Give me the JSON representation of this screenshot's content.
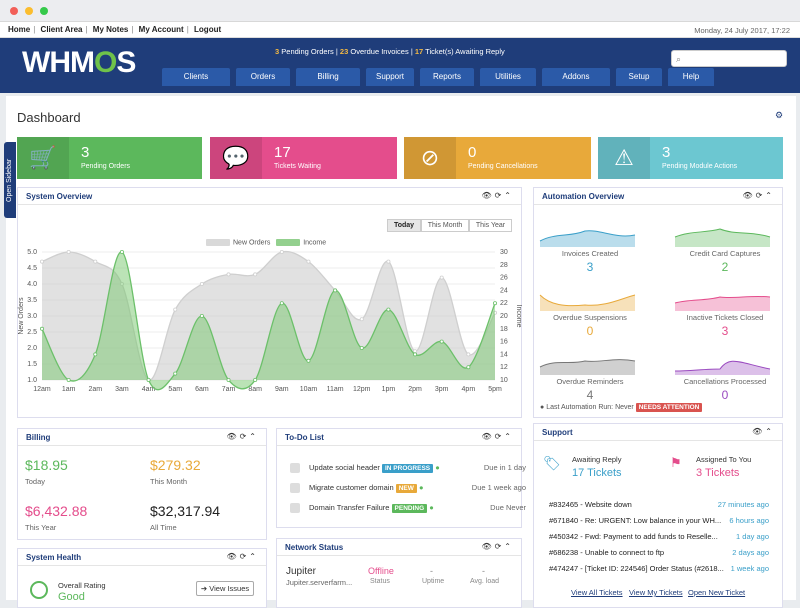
{
  "topbar": {
    "links": [
      "Home",
      "Client Area",
      "My Notes",
      "My Account",
      "Logout"
    ],
    "date": "Monday, 24 July 2017, 17:22"
  },
  "header": {
    "logo_prefix": "WHM",
    "logo_o": "O",
    "logo_suffix": "S",
    "alerts": {
      "pending_orders_n": "3",
      "pending_orders_l": "Pending Orders",
      "overdue_n": "23",
      "overdue_l": "Overdue Invoices",
      "tickets_n": "17",
      "tickets_l": "Ticket(s) Awaiting Reply"
    },
    "search_placeholder": ""
  },
  "nav": [
    "Clients",
    "Orders",
    "Billing",
    "Support",
    "Reports",
    "Utilities",
    "Addons",
    "Setup",
    "Help"
  ],
  "sidebar_tab": "Open Sidebar",
  "page_title": "Dashboard",
  "tiles": [
    {
      "num": "3",
      "label": "Pending Orders",
      "color": "#5cb85c",
      "icon": "cart-icon"
    },
    {
      "num": "17",
      "label": "Tickets Waiting",
      "color": "#e44d8c",
      "icon": "chat-icon"
    },
    {
      "num": "0",
      "label": "Pending Cancellations",
      "color": "#e8a93a",
      "icon": "ban-icon"
    },
    {
      "num": "3",
      "label": "Pending Module Actions",
      "color": "#6cc7d1",
      "icon": "warning-icon"
    }
  ],
  "system_overview": {
    "title": "System Overview",
    "tabs": [
      "Today",
      "This Month",
      "This Year"
    ],
    "legend": [
      "New Orders",
      "Income"
    ]
  },
  "chart_data": {
    "type": "area",
    "x": [
      "12am",
      "1am",
      "2am",
      "3am",
      "4am",
      "5am",
      "6am",
      "7am",
      "8am",
      "9am",
      "10am",
      "11am",
      "12pm",
      "1pm",
      "2pm",
      "3pm",
      "4pm",
      "5pm"
    ],
    "ylabel": "New Orders",
    "y2label": "Income",
    "ylim": [
      1.0,
      5.0
    ],
    "y2lim": [
      10,
      30
    ],
    "yticks": [
      "1.0",
      "1.5",
      "2.0",
      "2.5",
      "3.0",
      "3.5",
      "4.0",
      "4.5",
      "5.0"
    ],
    "y2ticks": [
      "10",
      "12",
      "14",
      "16",
      "18",
      "20",
      "22",
      "24",
      "26",
      "28",
      "30"
    ],
    "series": [
      {
        "name": "New Orders",
        "axis": "left",
        "color": "#cfcfcf",
        "values": [
          4.7,
          5.0,
          4.7,
          4.0,
          1.0,
          3.2,
          4.0,
          4.3,
          4.3,
          5.0,
          4.7,
          3.8,
          2.9,
          4.7,
          1.9,
          4.2,
          1.8,
          3.1
        ]
      },
      {
        "name": "Income",
        "axis": "right",
        "color": "#6cc06a",
        "values": [
          18,
          10,
          14,
          30,
          10,
          11,
          20,
          10,
          10,
          22,
          13,
          24,
          15,
          21,
          14,
          16,
          12,
          22
        ]
      }
    ]
  },
  "automation": {
    "title": "Automation Overview",
    "cells": [
      {
        "label": "Invoices Created",
        "value": "3",
        "color": "#3a9fc9"
      },
      {
        "label": "Credit Card Captures",
        "value": "2",
        "color": "#5cb85c"
      },
      {
        "label": "Overdue Suspensions",
        "value": "0",
        "color": "#e8a93a"
      },
      {
        "label": "Inactive Tickets Closed",
        "value": "3",
        "color": "#e44d8c"
      },
      {
        "label": "Overdue Reminders",
        "value": "4",
        "color": "#777777"
      },
      {
        "label": "Cancellations Processed",
        "value": "0",
        "color": "#9a4ac0"
      }
    ],
    "last_run": "Last Automation Run: Never",
    "needs_attention": "NEEDS ATTENTION"
  },
  "billing": {
    "title": "Billing",
    "today": "$18.95",
    "today_l": "Today",
    "month": "$279.32",
    "month_l": "This Month",
    "year": "$6,432.88",
    "year_l": "This Year",
    "all": "$32,317.94",
    "all_l": "All Time"
  },
  "todo": {
    "title": "To-Do List",
    "items": [
      {
        "text": "Update social header",
        "badge": "IN PROGRESS",
        "badge_color": "#3a9fc9",
        "due": "Due in 1 day"
      },
      {
        "text": "Migrate customer domain",
        "badge": "NEW",
        "badge_color": "#e8a93a",
        "due": "Due 1 week ago"
      },
      {
        "text": "Domain Transfer Failure",
        "badge": "PENDING",
        "badge_color": "#5cb85c",
        "due": "Due Never"
      }
    ]
  },
  "support": {
    "title": "Support",
    "awaiting_l": "Awaiting Reply",
    "awaiting_v": "17 Tickets",
    "assigned_l": "Assigned To You",
    "assigned_v": "3 Tickets",
    "tickets": [
      {
        "text": "#832465 - Website down",
        "age": "27 minutes ago"
      },
      {
        "text": "#671840 - Re: URGENT: Low balance in your WH...",
        "age": "6 hours ago"
      },
      {
        "text": "#450342 - Fwd: Payment to add funds to Reselle...",
        "age": "1 day ago"
      },
      {
        "text": "#686238 - Unable to connect to ftp",
        "age": "2 days ago"
      },
      {
        "text": "#474247 - [Ticket ID: 224546] Order Status (#2618...",
        "age": "1 week ago"
      }
    ],
    "links": [
      "View All Tickets",
      "View My Tickets",
      "Open New Ticket"
    ]
  },
  "system_health": {
    "title": "System Health",
    "rating_l": "Overall Rating",
    "rating_v": "Good",
    "view_issues": "View Issues"
  },
  "network": {
    "title": "Network Status",
    "server": "Jupiter",
    "host": "Jupiter.serverfarm...",
    "status": "Offline",
    "cols": [
      "Status",
      "Uptime",
      "Avg. load"
    ],
    "uptime": "-",
    "load": "-"
  }
}
